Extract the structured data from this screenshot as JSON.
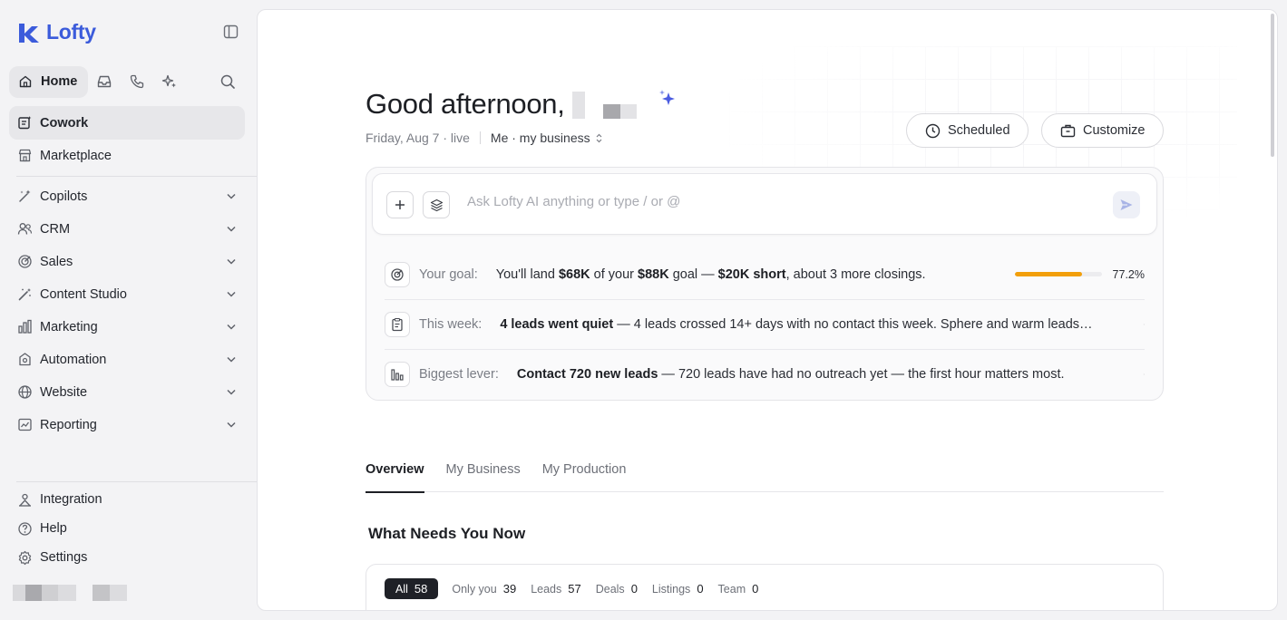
{
  "brand": {
    "name": "Lofty",
    "color": "#3b5bdb"
  },
  "topnav": {
    "home_label": "Home",
    "icons": [
      "inbox-icon",
      "phone-icon",
      "sparkles-icon",
      "search-icon"
    ]
  },
  "sidebar": {
    "primary": [
      {
        "label": "Cowork",
        "icon": "cowork-icon",
        "active": true
      },
      {
        "label": "Marketplace",
        "icon": "marketplace-icon",
        "active": false
      }
    ],
    "sections": [
      {
        "label": "Copilots",
        "icon": "copilot-wand-icon"
      },
      {
        "label": "CRM",
        "icon": "people-icon"
      },
      {
        "label": "Sales",
        "icon": "target-icon"
      },
      {
        "label": "Content Studio",
        "icon": "magic-wand-icon"
      },
      {
        "label": "Marketing",
        "icon": "bar-chart-icon"
      },
      {
        "label": "Automation",
        "icon": "automation-icon"
      },
      {
        "label": "Website",
        "icon": "globe-icon"
      },
      {
        "label": "Reporting",
        "icon": "report-chart-icon"
      }
    ],
    "footer": [
      {
        "label": "Integration",
        "icon": "integration-icon"
      },
      {
        "label": "Help",
        "icon": "help-circle-icon"
      },
      {
        "label": "Settings",
        "icon": "gear-icon"
      }
    ]
  },
  "header": {
    "greeting": "Good afternoon,",
    "date_status": "Friday, Aug 7 · live",
    "scope": "Me · my business",
    "scheduled_label": "Scheduled",
    "customize_label": "Customize"
  },
  "ask": {
    "placeholder": "Ask Lofty AI anything or type / or @"
  },
  "insights": {
    "goal": {
      "label": "Your goal:",
      "t1": "You'll land ",
      "amount": "$68K",
      "t2": " of your ",
      "goal": "$88K",
      "t3": " goal — ",
      "short": "$20K short",
      "t4": ", about 3 more closings.",
      "progress_pct": 77.2,
      "progress_label": "77.2%",
      "progress_color": "#f29f0a"
    },
    "week": {
      "label": "This week:",
      "headline": "4 leads went quiet",
      "detail": " — 4 leads crossed 14+ days with no contact this week. Sphere and warm leads co..."
    },
    "lever": {
      "label": "Biggest lever:",
      "headline": "Contact 720 new leads",
      "detail": " — 720 leads have had no outreach yet — the first hour matters most."
    }
  },
  "tabs": [
    {
      "label": "Overview",
      "active": true
    },
    {
      "label": "My Business",
      "active": false
    },
    {
      "label": "My Production",
      "active": false
    }
  ],
  "needs": {
    "title": "What Needs You Now",
    "filters": [
      {
        "label": "All",
        "count": "58",
        "active": true
      },
      {
        "label": "Only you",
        "count": "39",
        "active": false
      },
      {
        "label": "Leads",
        "count": "57",
        "active": false
      },
      {
        "label": "Deals",
        "count": "0",
        "active": false
      },
      {
        "label": "Listings",
        "count": "0",
        "active": false
      },
      {
        "label": "Team",
        "count": "0",
        "active": false
      }
    ]
  }
}
